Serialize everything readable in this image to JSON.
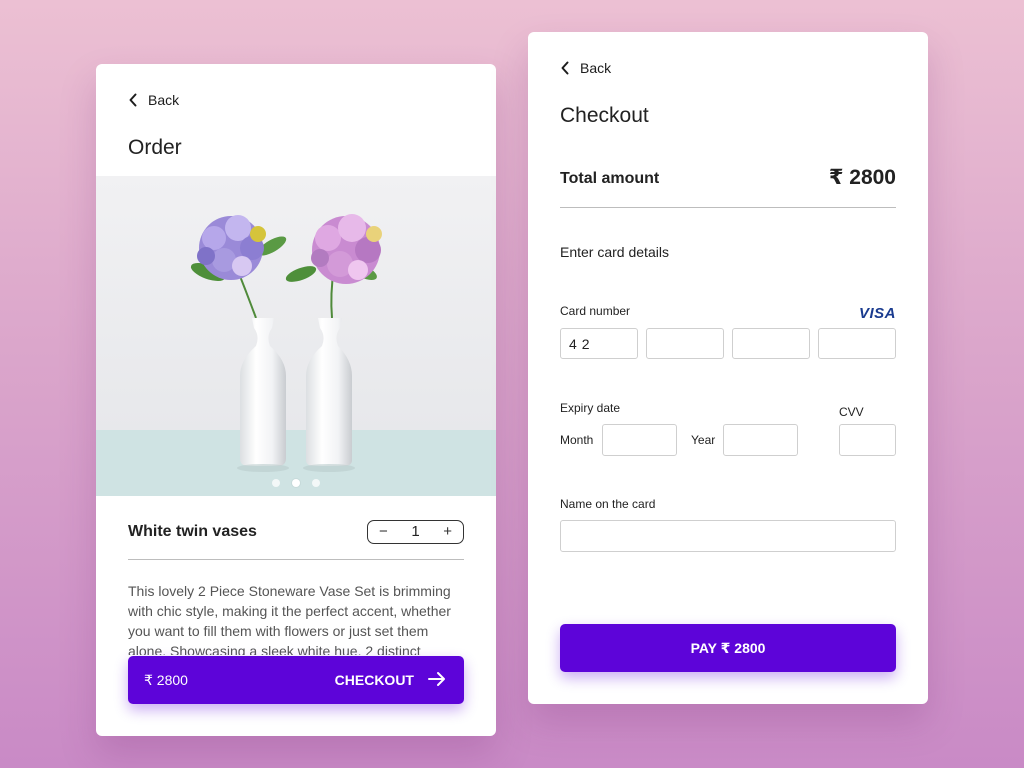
{
  "order": {
    "back_label": "Back",
    "title": "Order",
    "image_icon": "vase-photo",
    "carousel": {
      "count": 3,
      "active_index": 1
    },
    "product_name": "White twin vases",
    "quantity": "1",
    "decrement_symbol": "−",
    "increment_symbol": "+",
    "description": "This lovely 2 Piece Stoneware Vase Set is brimming with chic style, making it the perfect accent, whether you want to fill them with flowers or just set them alone. Showcasing a sleek white hue, 2 distinct",
    "checkout_price": "₹ 2800",
    "checkout_label": "CHECKOUT"
  },
  "checkout": {
    "back_label": "Back",
    "title": "Checkout",
    "total_label": "Total amount",
    "total_value": "₹ 2800",
    "section_title": "Enter card details",
    "card_number_label": "Card number",
    "card_brand": "VISA",
    "card_number_values": [
      "42",
      "",
      "",
      ""
    ],
    "expiry_label": "Expiry date",
    "month_label": "Month",
    "year_label": "Year",
    "cvv_label": "CVV",
    "name_label": "Name on the card",
    "pay_label": "PAY ₹ 2800"
  },
  "colors": {
    "accent": "#5d04d9",
    "background_top": "#ecc0d3",
    "background_bottom": "#c98ac6"
  }
}
